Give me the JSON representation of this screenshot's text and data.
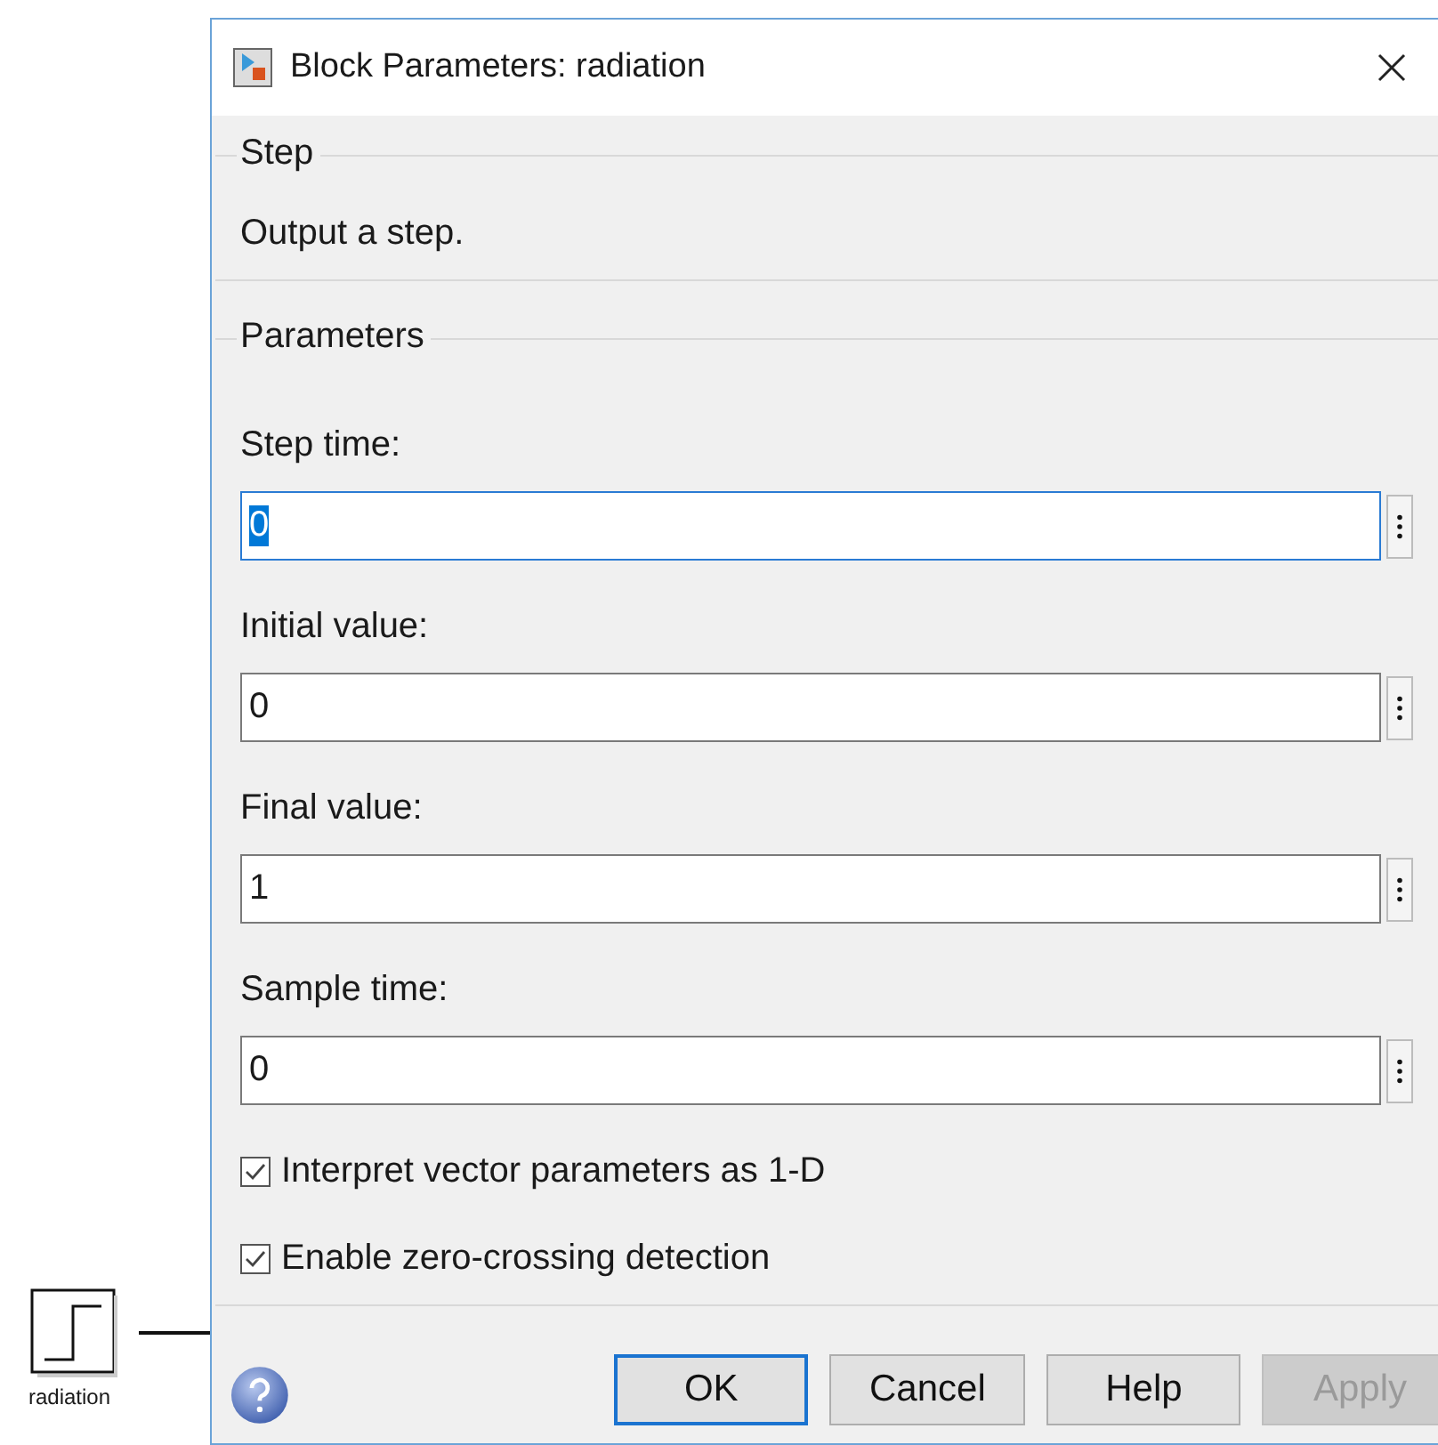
{
  "window": {
    "title": "Block Parameters: radiation"
  },
  "description_group": {
    "title": "Step",
    "text": "Output a step."
  },
  "parameters_group": {
    "title": "Parameters",
    "fields": [
      {
        "label": "Step time:",
        "value": "0",
        "focused": true
      },
      {
        "label": "Initial value:",
        "value": "0",
        "focused": false
      },
      {
        "label": "Final value:",
        "value": "1",
        "focused": false
      },
      {
        "label": "Sample time:",
        "value": "0",
        "focused": false
      }
    ],
    "checkboxes": [
      {
        "label": "Interpret vector parameters as 1-D",
        "checked": true
      },
      {
        "label": "Enable zero-crossing detection",
        "checked": true
      }
    ]
  },
  "buttons": [
    {
      "label": "OK",
      "default": true,
      "disabled": false
    },
    {
      "label": "Cancel",
      "default": false,
      "disabled": false
    },
    {
      "label": "Help",
      "default": false,
      "disabled": false
    },
    {
      "label": "Apply",
      "default": false,
      "disabled": true
    }
  ],
  "canvas_block": {
    "label": "radiation"
  }
}
